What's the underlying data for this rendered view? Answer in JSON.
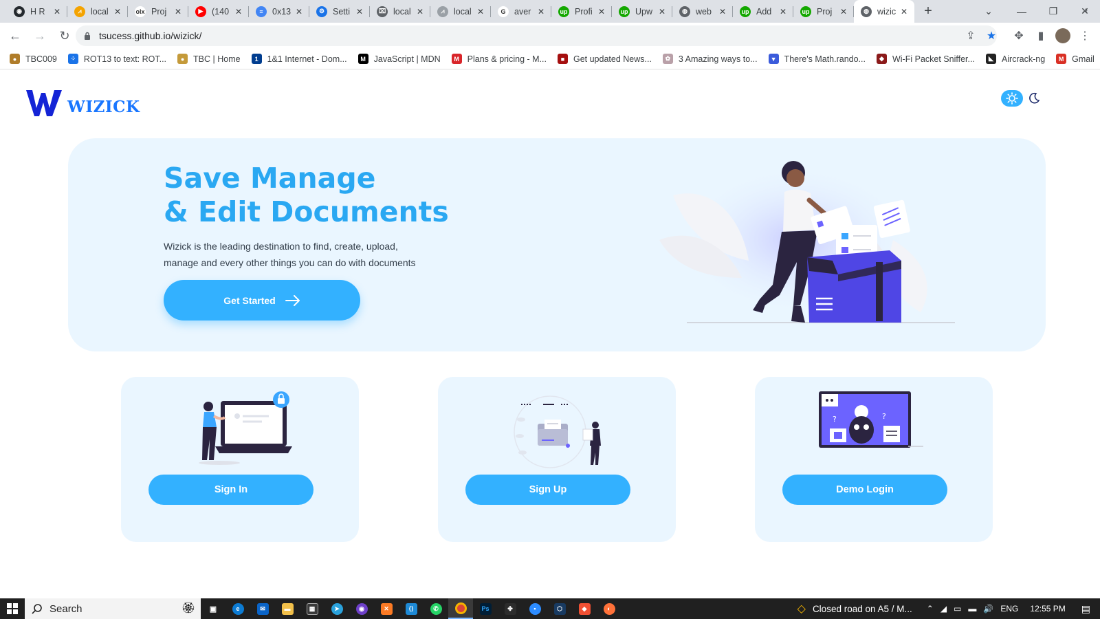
{
  "browser": {
    "tabs": [
      {
        "label": "H R",
        "fav_color": "#24292e",
        "fav_glyph": "◉"
      },
      {
        "label": "local",
        "fav_color": "#f4a300",
        "fav_glyph": "⩘"
      },
      {
        "label": "Proj",
        "fav_color": "#ffffff",
        "fav_glyph": "olx"
      },
      {
        "label": "(140",
        "fav_color": "#ff0000",
        "fav_glyph": "▶"
      },
      {
        "label": "0x13",
        "fav_color": "#4285f4",
        "fav_glyph": "≡"
      },
      {
        "label": "Setti",
        "fav_color": "#1a73e8",
        "fav_glyph": "⚙"
      },
      {
        "label": "local",
        "fav_color": "#5f6368",
        "fav_glyph": "⌧"
      },
      {
        "label": "local",
        "fav_color": "#9aa0a6",
        "fav_glyph": "⩘"
      },
      {
        "label": "aver",
        "fav_color": "#ffffff",
        "fav_glyph": "G"
      },
      {
        "label": "Profi",
        "fav_color": "#14a800",
        "fav_glyph": "up"
      },
      {
        "label": "Upw",
        "fav_color": "#14a800",
        "fav_glyph": "up"
      },
      {
        "label": "web",
        "fav_color": "#5f6368",
        "fav_glyph": "◍"
      },
      {
        "label": "Add",
        "fav_color": "#14a800",
        "fav_glyph": "up"
      },
      {
        "label": "Proj",
        "fav_color": "#14a800",
        "fav_glyph": "up"
      },
      {
        "label": "wizic",
        "fav_color": "#5f6368",
        "fav_glyph": "◍",
        "active": true
      }
    ],
    "url": "tsucess.github.io/wizick/",
    "bookmarks": [
      {
        "label": "TBC009",
        "color": "#b07d2a",
        "glyph": "●"
      },
      {
        "label": "ROT13 to text: ROT...",
        "color": "#1a73e8",
        "glyph": "⁘"
      },
      {
        "label": "TBC | Home",
        "color": "#c49a3a",
        "glyph": "●"
      },
      {
        "label": "1&1 Internet - Dom...",
        "color": "#003d8f",
        "glyph": "1"
      },
      {
        "label": "JavaScript | MDN",
        "color": "#000000",
        "glyph": "M"
      },
      {
        "label": "Plans & pricing - M...",
        "color": "#d9252a",
        "glyph": "M"
      },
      {
        "label": "Get updated News...",
        "color": "#a50f0f",
        "glyph": "■"
      },
      {
        "label": "3 Amazing ways to...",
        "color": "#b9a0a8",
        "glyph": "✿"
      },
      {
        "label": "There's Math.rando...",
        "color": "#3b5bdb",
        "glyph": "▼"
      },
      {
        "label": "Wi-Fi Packet Sniffer...",
        "color": "#8b1a1a",
        "glyph": "◆"
      },
      {
        "label": "Aircrack-ng",
        "color": "#222222",
        "glyph": "◣"
      },
      {
        "label": "Gmail",
        "color": "#d93025",
        "glyph": "M"
      }
    ]
  },
  "site": {
    "brand": "WIZICK",
    "hero": {
      "title_line1": "Save Manage",
      "title_line2": "& Edit Documents",
      "desc_line1": "Wizick is the leading destination to find, create, upload,",
      "desc_line2": "manage and every other things you can do with documents",
      "cta_label": "Get Started"
    },
    "cards": [
      {
        "label": "Sign In"
      },
      {
        "label": "Sign Up"
      },
      {
        "label": "Demo Login"
      }
    ],
    "colors": {
      "accent": "#33b1ff",
      "hero_bg": "#eaf6ff",
      "title": "#2aa8f2",
      "brand": "#1976ff",
      "illustration": "#4f46e5"
    }
  },
  "taskbar": {
    "search_placeholder": "Search",
    "news": "Closed road on A5 / M...",
    "lang": "ENG",
    "time": "12:55 PM"
  }
}
